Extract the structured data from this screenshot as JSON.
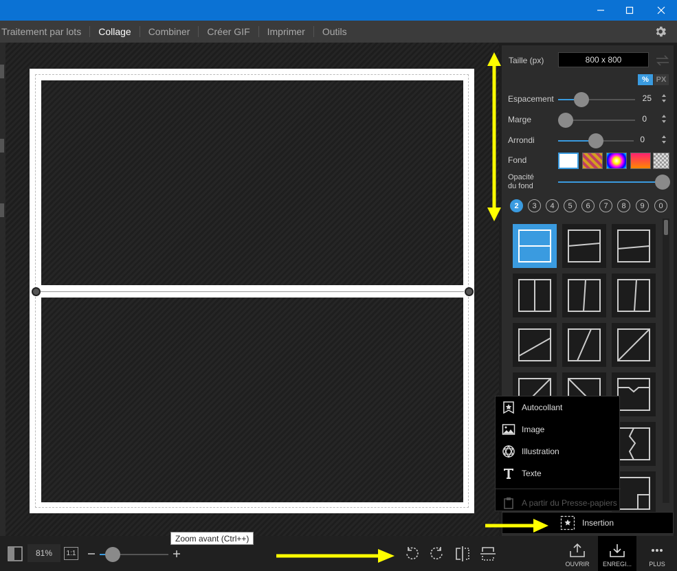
{
  "menu": {
    "items": [
      {
        "label": "Traitement par lots",
        "active": false
      },
      {
        "label": "Collage",
        "active": true
      },
      {
        "label": "Combiner",
        "active": false
      },
      {
        "label": "Créer GIF",
        "active": false
      },
      {
        "label": "Imprimer",
        "active": false
      },
      {
        "label": "Outils",
        "active": false
      }
    ]
  },
  "panel": {
    "size_label": "Taille (px)",
    "size_value": "800 x 800",
    "unit_percent": "%",
    "unit_px": "PX",
    "spacing_label": "Espacement",
    "spacing_value": "25",
    "margin_label": "Marge",
    "margin_value": "0",
    "rounding_label": "Arrondi",
    "rounding_value": "0",
    "background_label": "Fond",
    "bg_opacity_label_1": "Opacité",
    "bg_opacity_label_2": "du fond",
    "image_counts": [
      "2",
      "3",
      "4",
      "5",
      "6",
      "7",
      "8",
      "9",
      "0"
    ],
    "selected_count": "2"
  },
  "popup": {
    "items": [
      "Autocollant",
      "Image",
      "Illustration",
      "Texte"
    ],
    "disabled_item": "A partir du Presse-papiers",
    "insert_label": "Insertion"
  },
  "bottom": {
    "zoom_value": "81%",
    "one_to_one": "1:1",
    "zoom_tooltip": "Zoom avant (Ctrl++)",
    "open_label": "OUVRIR",
    "save_label": "ENREGI...",
    "more_label": "PLUS"
  },
  "colors": {
    "accent": "#3a9be0",
    "titlebar": "#0b72d4",
    "annotation": "#ffff00"
  }
}
